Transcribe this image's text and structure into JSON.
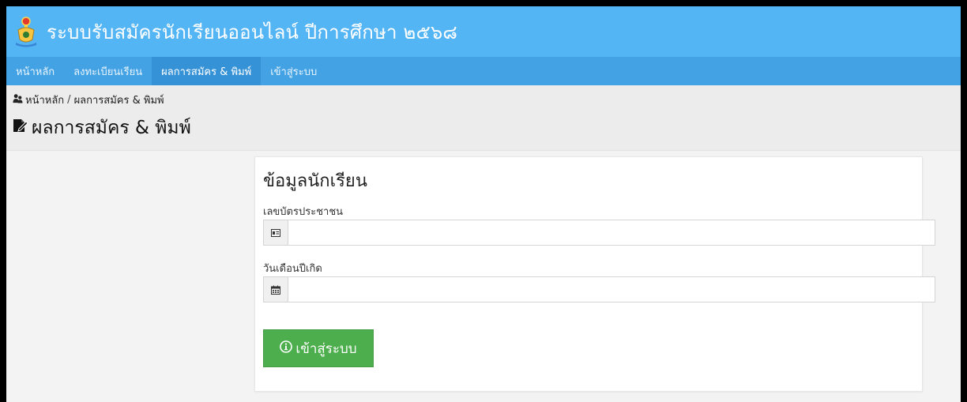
{
  "header": {
    "title": "ระบบรับสมัครนักเรียนออนไลน์ ปีการศึกษา ๒๕๖๘",
    "logo_icon": "school-emblem-icon",
    "background_color": "#54b5f5"
  },
  "nav": {
    "background_color": "#43a2e4",
    "active_color": "#3692d6",
    "items": [
      {
        "label": "หน้าหลัก"
      },
      {
        "label": "ลงทะเบียนเรียน"
      },
      {
        "label": "ผลการสมัคร & พิมพ์",
        "active": true
      },
      {
        "label": "เข้าสู่ระบบ"
      }
    ]
  },
  "breadcrumb": {
    "icon": "people-icon",
    "home": "หน้าหลัก",
    "separator": "/",
    "current": "ผลการสมัคร & พิมพ์"
  },
  "page": {
    "title_icon": "document-edit-icon",
    "title": "ผลการสมัคร & พิมพ์"
  },
  "form": {
    "heading": "ข้อมูลนักเรียน",
    "id_card": {
      "label": "เลขบัตรประชาชน",
      "icon": "id-card-icon",
      "value": "",
      "placeholder": ""
    },
    "birth_date": {
      "label": "วันเดือนปีเกิด",
      "icon": "calendar-icon",
      "value": "",
      "placeholder": ""
    },
    "submit": {
      "icon": "info-circle-icon",
      "label": "เข้าสู่ระบบ",
      "color": "#4cae4c"
    }
  }
}
